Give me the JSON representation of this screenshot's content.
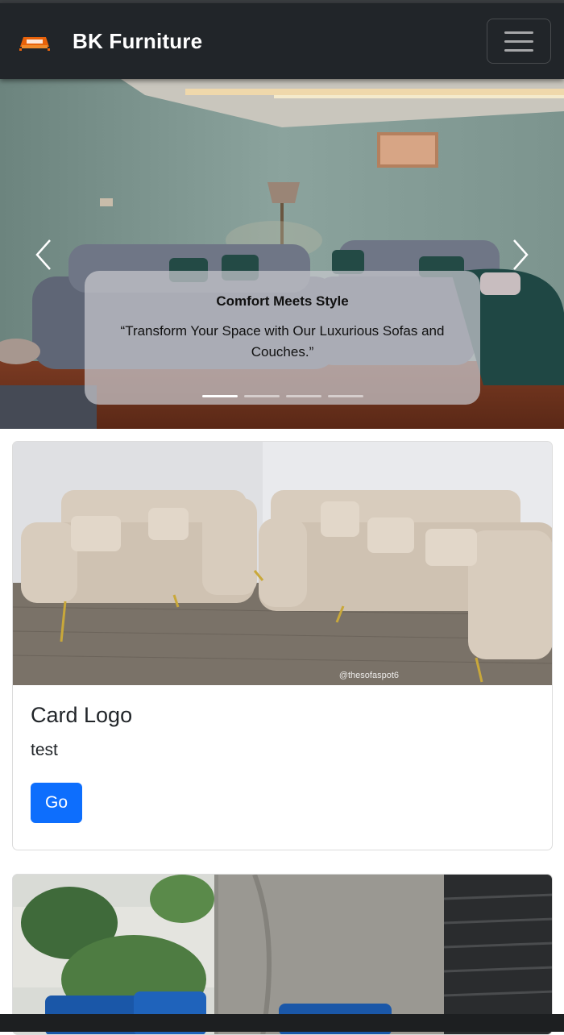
{
  "navbar": {
    "brand": "BK Furniture",
    "logo_icon": "sofa-logo-icon",
    "toggler_icon": "hamburger-menu-icon",
    "background": "#212529"
  },
  "carousel": {
    "caption_title": "Comfort Meets Style",
    "caption_text": "“Transform Your Space with Our Luxurious Sofas and Couches.”",
    "slide_count": 4,
    "active_slide": 1,
    "prev_icon": "chevron-left-icon",
    "next_icon": "chevron-right-icon",
    "slide_image": "living-room-sofa-set-photo"
  },
  "cards": [
    {
      "image": "cream-sofa-set-photo",
      "image_watermark": "@thesofaspot6",
      "title": "Card Logo",
      "text": "test",
      "button_label": "Go"
    },
    {
      "image": "blue-sofa-outdoor-photo"
    }
  ],
  "colors": {
    "primary_button": "#0d6efd",
    "navbar": "#212529"
  }
}
